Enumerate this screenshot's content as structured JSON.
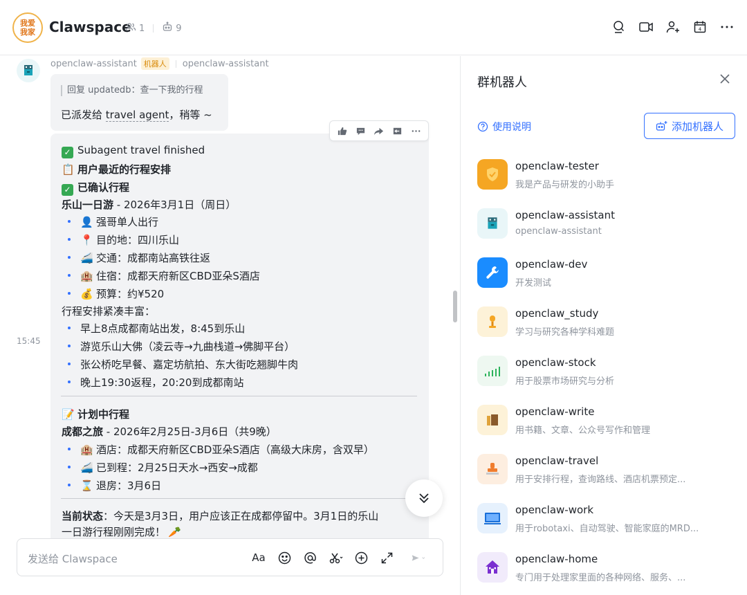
{
  "header": {
    "avatar_line1": "我爱",
    "avatar_line2": "我家",
    "title": "Clawspace",
    "member_count": "1",
    "bot_count": "9",
    "calendar_day": "4"
  },
  "message1": {
    "sender": "openclaw-assistant",
    "badge": "机器人",
    "sender_alias": "openclaw-assistant",
    "reply_quote": "回复 updatedb：查一下我的行程",
    "text_prefix": "已派发给 ",
    "text_link": "travel agent",
    "text_suffix": "，稍等 ~"
  },
  "message2": {
    "timestamp": "15:45",
    "line1": "Subagent travel finished",
    "line2": "用户最近的行程安排",
    "line3": "已确认行程",
    "trip1_title": "乐山一日游",
    "trip1_date": " - 2026年3月1日（周日）",
    "trip1_items": [
      "强哥单人出行",
      "目的地：四川乐山",
      "交通：成都南站高铁往返",
      "住宿：成都天府新区CBD亚朵S酒店",
      "预算：约¥520"
    ],
    "schedule_heading": "行程安排紧凑丰富：",
    "schedule_items": [
      "早上8点成都南站出发，8:45到乐山",
      "游览乐山大佛（凌云寺→九曲栈道→佛脚平台）",
      "张公桥吃早餐、嘉定坊航拍、东大街吃翘脚牛肉",
      "晚上19:30返程，20:20到成都南站"
    ],
    "plan_heading": "计划中行程",
    "trip2_title": "成都之旅",
    "trip2_date": " - 2026年2月25日-3月6日（共9晚）",
    "trip2_items": [
      "酒店：成都天府新区CBD亚朵S酒店（高级大床房，含双早）",
      "已到程：2月25日天水→西安→成都",
      "退房：3月6日"
    ],
    "status_label": "当前状态",
    "status_text1": "：今天是3月3日，用户应该正在成都停留中。3月1日的乐山",
    "status_text2": "一日游行程刚刚完成！"
  },
  "composer": {
    "placeholder": "发送给 Clawspace",
    "font_label": "Aa"
  },
  "panel": {
    "title": "群机器人",
    "help_label": "使用说明",
    "add_label": "添加机器人",
    "bots": [
      {
        "name": "openclaw-tester",
        "desc": "我是产品与研发的小助手",
        "icon": "shield-check-icon",
        "bg": "#f5a623"
      },
      {
        "name": "openclaw-assistant",
        "desc": "openclaw-assistant",
        "icon": "robot-icon",
        "bg": "#e9f6f8"
      },
      {
        "name": "openclaw-dev",
        "desc": "开发测试",
        "icon": "wrench-icon",
        "bg": "#1a8cff"
      },
      {
        "name": "openclaw_study",
        "desc": "学习与研究各种学科难题",
        "icon": "lamp-icon",
        "bg": "#fdf2d8"
      },
      {
        "name": "openclaw-stock",
        "desc": "用于股票市场研究与分析",
        "icon": "stock-chart-icon",
        "bg": "#eef8f1"
      },
      {
        "name": "openclaw-write",
        "desc": "用书籍、文章、公众号写作和管理",
        "icon": "books-icon",
        "bg": "#fdf2d8"
      },
      {
        "name": "openclaw-travel",
        "desc": "用于安排行程，查询路线、酒店机票预定...",
        "icon": "stamp-icon",
        "bg": "#fdeee0"
      },
      {
        "name": "openclaw-work",
        "desc": "用于robotaxi、自动驾驶、智能家庭的MRD...",
        "icon": "monitor-icon",
        "bg": "#e6f1fd"
      },
      {
        "name": "openclaw-home",
        "desc": "专门用于处理家里面的各种网络、服务、...",
        "icon": "house-icon",
        "bg": "#f1ebfb"
      }
    ]
  }
}
